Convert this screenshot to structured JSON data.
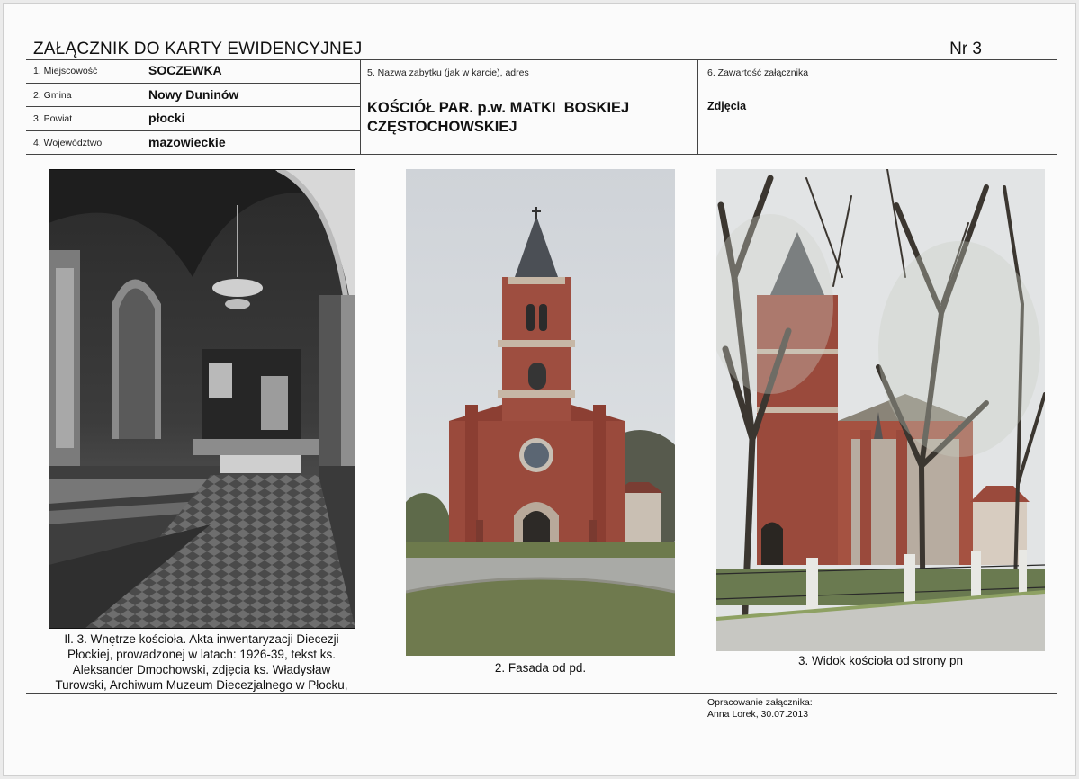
{
  "header": {
    "title": "ZAŁĄCZNIK DO KARTY EWIDENCYJNEJ",
    "number": "Nr 3"
  },
  "fields": {
    "miejscowosc_label": "1. Miejscowość",
    "miejscowosc_value": "SOCZEWKA",
    "gmina_label": "2. Gmina",
    "gmina_value": "Nowy Duninów",
    "powiat_label": "3. Powiat",
    "powiat_value": "płocki",
    "wojewodztwo_label": "4. Województwo",
    "wojewodztwo_value": "mazowieckie",
    "nazwa_label": "5. Nazwa zabytku (jak w karcie), adres",
    "nazwa_line1": "KOŚCIÓŁ PAR. p.w. MATKI  BOSKIEJ",
    "nazwa_line2": "CZĘSTOCHOWSKIEJ",
    "zawartosc_label": "6. Zawartość załącznika",
    "zawartosc_value": "Zdjęcia"
  },
  "photos": [
    {
      "caption_lines": [
        "Il. 3. Wnętrze kościoła. Akta inwentaryzacji Diecezji",
        "Płockiej, prowadzonej w latach: 1926-39, tekst ks.",
        "Aleksander Dmochowski, zdjęcia ks. Władysław",
        "Turowski, Archiwum Muzeum Diecezjalnego w Płocku,"
      ]
    },
    {
      "caption": "2. Fasada od pd."
    },
    {
      "caption": "3. Widok kościoła od strony pn"
    }
  ],
  "footer": {
    "line1": "Opracowanie załącznika:",
    "line2": "Anna Lorek, 30.07.2013"
  },
  "colors": {
    "brick": "#9a4a3c",
    "sky": "#d6dade",
    "grass": "#6f7a4e",
    "road": "#a9aaa6"
  }
}
